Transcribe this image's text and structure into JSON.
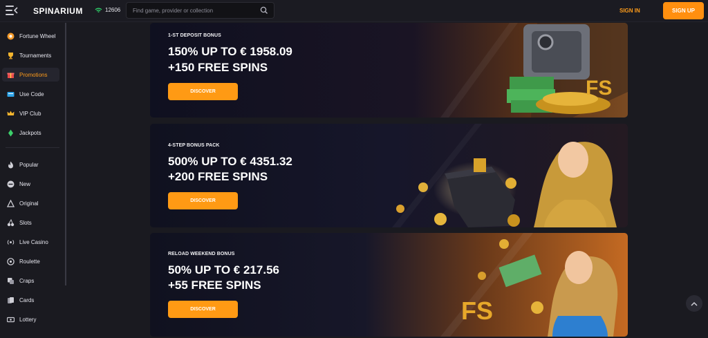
{
  "header": {
    "logo": "SPINARIUM",
    "online_count": "12606",
    "search_placeholder": "Find game, provider or collection",
    "signin_label": "SIGN IN",
    "signup_label": "SIGN UP"
  },
  "sidebar": {
    "items": [
      {
        "label": "Fortune Wheel",
        "icon": "wheel-icon"
      },
      {
        "label": "Tournaments",
        "icon": "trophy-icon"
      },
      {
        "label": "Promotions",
        "icon": "gift-icon"
      },
      {
        "label": "Use Code",
        "icon": "code-icon"
      },
      {
        "label": "VIP Club",
        "icon": "crown-icon"
      },
      {
        "label": "Jackpots",
        "icon": "diamond-icon"
      },
      {
        "label": "Popular",
        "icon": "fire-icon"
      },
      {
        "label": "New",
        "icon": "new-icon"
      },
      {
        "label": "Original",
        "icon": "triangle-icon"
      },
      {
        "label": "Slots",
        "icon": "cherry-icon"
      },
      {
        "label": "Live Casino",
        "icon": "live-icon"
      },
      {
        "label": "Roulette",
        "icon": "roulette-icon"
      },
      {
        "label": "Craps",
        "icon": "dice-icon"
      },
      {
        "label": "Cards",
        "icon": "cards-icon"
      },
      {
        "label": "Lottery",
        "icon": "lottery-icon"
      }
    ]
  },
  "promos": [
    {
      "kicker": "1-ST DEPOSIT BONUS",
      "line1": "150% UP TO € 1958.09",
      "line2": "+150 FREE SPINS",
      "button": "DISCOVER"
    },
    {
      "kicker": "4-STEP BONUS PACK",
      "line1": "500% UP TO € 4351.32",
      "line2": "+200 FREE SPINS",
      "button": "DISCOVER"
    },
    {
      "kicker": "RELOAD WEEKEND BONUS",
      "line1": "50% UP TO € 217.56",
      "line2": "+55 FREE SPINS",
      "button": "DISCOVER"
    }
  ],
  "colors": {
    "accent": "#ff9a14",
    "background": "#1a1a20"
  }
}
